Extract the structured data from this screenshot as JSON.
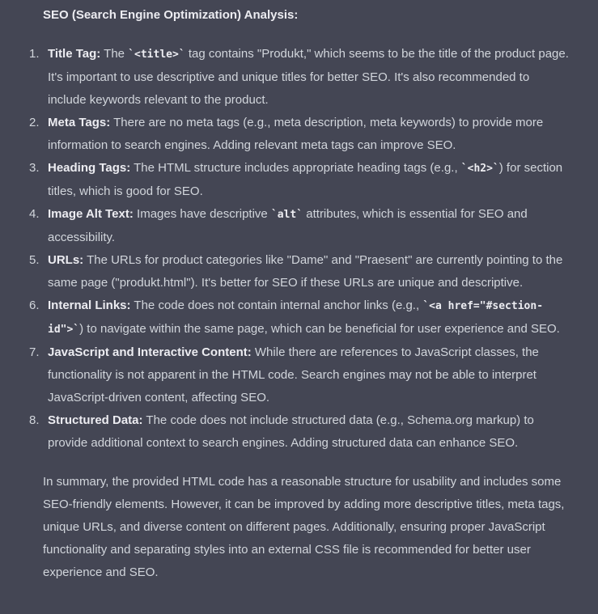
{
  "heading": "SEO (Search Engine Optimization) Analysis:",
  "items": [
    {
      "num": "1.",
      "term": "Title Tag:",
      "pre": " The ",
      "code": "`<title>`",
      "post": " tag contains \"Produkt,\" which seems to be the title of the product page. It's important to use descriptive and unique titles for better SEO. It's also recommended to include keywords relevant to the product."
    },
    {
      "num": "2.",
      "term": "Meta Tags:",
      "pre": " There are no meta tags (e.g., meta description, meta keywords) to provide more information to search engines. Adding relevant meta tags can improve SEO.",
      "code": "",
      "post": ""
    },
    {
      "num": "3.",
      "term": "Heading Tags:",
      "pre": " The HTML structure includes appropriate heading tags (e.g., ",
      "code": "`<h2>`",
      "post": ") for section titles, which is good for SEO."
    },
    {
      "num": "4.",
      "term": "Image Alt Text:",
      "pre": " Images have descriptive ",
      "code": "`alt`",
      "post": " attributes, which is essential for SEO and accessibility."
    },
    {
      "num": "5.",
      "term": "URLs:",
      "pre": " The URLs for product categories like \"Dame\" and \"Praesent\" are currently pointing to the same page (\"produkt.html\"). It's better for SEO if these URLs are unique and descriptive.",
      "code": "",
      "post": ""
    },
    {
      "num": "6.",
      "term": "Internal Links:",
      "pre": " The code does not contain internal anchor links (e.g., ",
      "code": "`<a href=\"#section-id\">`",
      "post": ") to navigate within the same page, which can be beneficial for user experience and SEO."
    },
    {
      "num": "7.",
      "term": "JavaScript and Interactive Content:",
      "pre": " While there are references to JavaScript classes, the functionality is not apparent in the HTML code. Search engines may not be able to interpret JavaScript-driven content, affecting SEO.",
      "code": "",
      "post": ""
    },
    {
      "num": "8.",
      "term": "Structured Data:",
      "pre": " The code does not include structured data (e.g., Schema.org markup) to provide additional context to search engines. Adding structured data can enhance SEO.",
      "code": "",
      "post": ""
    }
  ],
  "summary": "In summary, the provided HTML code has a reasonable structure for usability and includes some SEO-friendly elements. However, it can be improved by adding more descriptive titles, meta tags, unique URLs, and diverse content on different pages. Additionally, ensuring proper JavaScript functionality and separating styles into an external CSS file is recommended for better user experience and SEO."
}
